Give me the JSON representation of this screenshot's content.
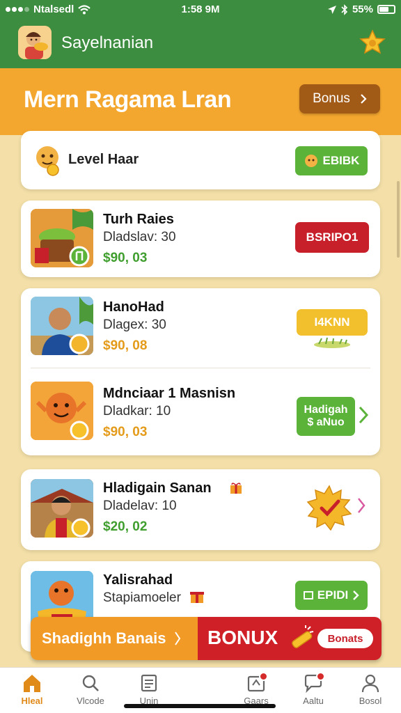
{
  "status_bar": {
    "carrier": "Ntalsedl",
    "time": "1:58 9M",
    "battery": "55%"
  },
  "header": {
    "title": "Sayelnanian",
    "avatar_icon": "chef-avatar-icon",
    "badge_icon": "star-badge-icon"
  },
  "hero": {
    "title": "Mern Ragama Lran",
    "bonus_button": "Bonus"
  },
  "level_card": {
    "label": "Level Haar",
    "button": "EBIBK"
  },
  "items": [
    {
      "title": "Turh Raies",
      "subtitle": "Dladslav: 30",
      "price": "$90, 03",
      "button": "BSRIPO1",
      "thumb_icon": "food-basket-icon"
    },
    {
      "title": "HanoHad",
      "subtitle": "Dlagex: 30",
      "price": "$90, 08",
      "button": "I4KNN",
      "thumb_icon": "man-avatar-icon"
    },
    {
      "title": "Mdnciaar 1 Masnisn",
      "subtitle": "Dladkar: 10",
      "price": "$90, 03",
      "button_line1": "Hadigah",
      "button_line2": "$ aNuo",
      "thumb_icon": "monster-icon"
    },
    {
      "title": "Hladigain Sanan",
      "subtitle": "Dladelav: 10",
      "price": "$20, 02",
      "thumb_icon": "villager-icon"
    },
    {
      "title": "Yalisrahad",
      "subtitle": "Stapiamoeler",
      "button": "EPIDI",
      "thumb_icon": "treasure-pot-icon"
    }
  ],
  "promo_banner": {
    "left_text": "Shadighh Banais",
    "main_text": "BONUX",
    "pill_text": "Bonats"
  },
  "bottom_nav": [
    {
      "label": "Hleal",
      "icon": "home-icon",
      "active": true
    },
    {
      "label": "Vlcode",
      "icon": "search-icon"
    },
    {
      "label": "Unin",
      "icon": "document-icon"
    },
    {
      "label": "Gaars",
      "icon": "inbox-icon",
      "badge": true
    },
    {
      "label": "Aaltu",
      "icon": "chat-bubble-icon",
      "badge": true
    },
    {
      "label": "Bosol",
      "icon": "profile-icon"
    }
  ],
  "colors": {
    "header_green": "#3c8d3f",
    "hero_orange": "#f4a72f",
    "accent_red": "#c8202b",
    "accent_green": "#5bb33a",
    "accent_yellow": "#f2c02c",
    "background_cream": "#f3dfa7"
  }
}
